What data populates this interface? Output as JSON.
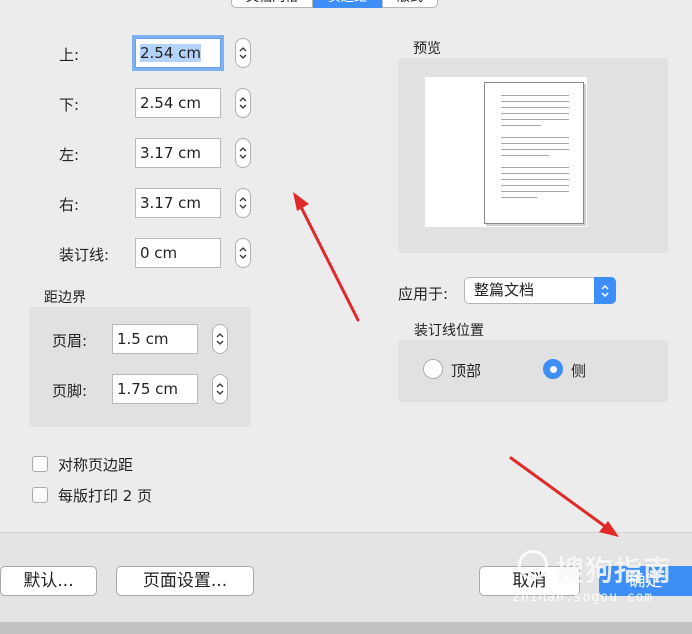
{
  "tabs": [
    {
      "label": "文档网格",
      "active": false
    },
    {
      "label": "页边距",
      "active": true
    },
    {
      "label": "版式",
      "active": false
    }
  ],
  "margins": {
    "top": {
      "label": "上:",
      "value": "2.54 cm"
    },
    "bottom": {
      "label": "下:",
      "value": "2.54 cm"
    },
    "left": {
      "label": "左:",
      "value": "3.17 cm"
    },
    "right": {
      "label": "右:",
      "value": "3.17 cm"
    },
    "gutter": {
      "label": "装订线:",
      "value": "0 cm"
    }
  },
  "from_edge": {
    "title": "距边界",
    "header": {
      "label": "页眉:",
      "value": "1.5 cm"
    },
    "footer": {
      "label": "页脚:",
      "value": "1.75 cm"
    }
  },
  "preview": {
    "title": "预览"
  },
  "apply_to": {
    "label": "应用于:",
    "selected": "整篇文档"
  },
  "gutter_position": {
    "title": "装订线位置",
    "options": [
      {
        "label": "顶部",
        "selected": false
      },
      {
        "label": "侧",
        "selected": true
      }
    ]
  },
  "checkboxes": [
    {
      "label": "对称页边距",
      "checked": false
    },
    {
      "label": "每版打印 2 页",
      "checked": false
    }
  ],
  "buttons": {
    "default": "默认...",
    "page_setup": "页面设置...",
    "cancel": "取消",
    "ok": "确定"
  },
  "watermark": {
    "text": "搜狗指南",
    "url": "zhinan.sogou.com"
  },
  "colors": {
    "accent": "#3d8ff7",
    "arrow": "#e02a2a"
  }
}
